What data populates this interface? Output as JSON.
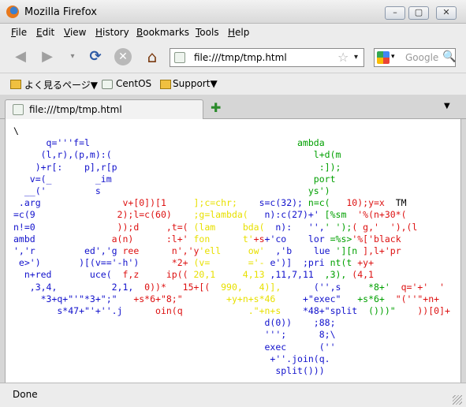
{
  "window": {
    "title": "Mozilla Firefox",
    "btn_min": "–",
    "btn_max": "▢",
    "btn_close": "✕"
  },
  "menu": [
    "File",
    "Edit",
    "View",
    "History",
    "Bookmarks",
    "Tools",
    "Help"
  ],
  "nav": {
    "back_glyph": "◀",
    "forward_glyph": "▶",
    "history_drop_glyph": "▾",
    "reload_glyph": "⟳",
    "stop_glyph": "✕",
    "home_glyph": "⌂",
    "url": "file:///tmp/tmp.html",
    "star_glyph": "☆",
    "url_drop_glyph": "▾",
    "search_placeholder": "Google",
    "search_drop_glyph": "▾",
    "search_go_glyph": "🔍"
  },
  "bookmarks": [
    "よく見るページ▼",
    "CentOS",
    "Support▼"
  ],
  "tab": {
    "label": "file:///tmp/tmp.html",
    "new_tab_glyph": "✚",
    "list_glyph": "▼"
  },
  "status": "Done",
  "icons": [
    "firefox-logo-icon",
    "back-arrow-icon",
    "forward-arrow-icon",
    "reload-icon",
    "stop-icon",
    "home-icon",
    "page-icon",
    "bookmark-star-icon",
    "google-icon",
    "magnifier-icon",
    "folder-icon",
    "new-tab-icon"
  ],
  "colors": {
    "black": "#000000",
    "blue": "#1111cc",
    "green": "#00a000",
    "red": "#dd1010",
    "yellow": "#e8e000"
  },
  "code_lines": [
    [
      [
        "k",
        "\\"
      ]
    ],
    [
      [
        "b",
        "      q='''f=l"
      ],
      [
        "g",
        "                                      ambda"
      ]
    ],
    [
      [
        "b",
        "     (l,r),(p,m):("
      ],
      [
        "g",
        "                                     l+d(m"
      ]
    ],
    [
      [
        "b",
        "    )+r[:    p],r[p"
      ],
      [
        "g",
        "                                     :]);"
      ]
    ],
    [
      [
        "b",
        "   v=(_        _im"
      ],
      [
        "g",
        "                                     port"
      ]
    ],
    [
      [
        "b",
        "  __('         s"
      ],
      [
        "g",
        "                                      ys')"
      ]
    ],
    [
      [
        "b",
        " .arg"
      ],
      [
        "r",
        "               v+[0])[1"
      ],
      [
        "y",
        "     ];c=chr;"
      ],
      [
        "b",
        "    s=c(32);"
      ],
      [
        "g",
        " n=c("
      ],
      [
        "r",
        "   10);y=x"
      ],
      [
        "k",
        "  TM"
      ]
    ],
    [
      [
        "b",
        "=c(9"
      ],
      [
        "r",
        "               2);l=c(60)"
      ],
      [
        "y",
        "    ;g=lambda("
      ],
      [
        "b",
        "   n):c(27)+'"
      ],
      [
        "g",
        " [%sm"
      ],
      [
        "r",
        "  '%(n+30*("
      ]
    ],
    [
      [
        "b",
        "n!=0"
      ],
      [
        "r",
        "               ));d     ,t=("
      ],
      [
        "y",
        " (lam     bda("
      ],
      [
        "b",
        "  n):   '',"
      ],
      [
        "g",
        "' ');"
      ],
      [
        "r",
        "( g,'  '),(l"
      ]
    ],
    [
      [
        "b",
        "ambd"
      ],
      [
        "r",
        "              a(n)      :l+'"
      ],
      [
        "y",
        " fon      t'"
      ],
      [
        "r",
        "+s"
      ],
      [
        "b",
        "+'co    lor"
      ],
      [
        "g",
        " =%s>"
      ],
      [
        "r",
        "'%['black"
      ]
    ],
    [
      [
        "b",
        "','r         ed','g"
      ],
      [
        "r",
        " ree      n','y"
      ],
      [
        "y",
        "'ell     ow'"
      ],
      [
        "b",
        "  ,'b    lue"
      ],
      [
        "g",
        " '][n"
      ],
      [
        "r",
        " ],l+'pr"
      ]
    ],
    [
      [
        "b",
        " e>')       )[(v=='-h')"
      ],
      [
        "r",
        "      *2+ "
      ],
      [
        "y",
        "(v=       ='-"
      ],
      [
        "b",
        " e')]  ;pri"
      ],
      [
        "g",
        " nt(t"
      ],
      [
        "r",
        " +y+"
      ]
    ],
    [
      [
        "b",
        "  n+red       uce("
      ],
      [
        "r",
        "  f,z     ip(("
      ],
      [
        "y",
        " 20,1     4,13"
      ],
      [
        "b",
        " ,11,7,11"
      ],
      [
        "g",
        "  ,3),"
      ],
      [
        "r",
        " (4,1"
      ]
    ],
    [
      [
        "b",
        "   ,3,4,          2,1,"
      ],
      [
        "r",
        "  0))*   15+[("
      ],
      [
        "y",
        "  990,   4)],"
      ],
      [
        "b",
        "      ('',s"
      ],
      [
        "g",
        "     *8+'"
      ],
      [
        "r",
        "  q='+'  '"
      ]
    ],
    [
      [
        "b",
        "     *3+q+\"'\"*3+\";\""
      ],
      [
        "r",
        "   +s*6+\"8;\""
      ],
      [
        "y",
        "        +y+n+s*46"
      ],
      [
        "b",
        "     +\"exec\""
      ],
      [
        "g",
        "   +s*6+"
      ],
      [
        "r",
        "  \"(''\"+n+"
      ]
    ],
    [
      [
        "b",
        "        s*47+\"'+''.j"
      ],
      [
        "r",
        "      oin(q"
      ],
      [
        "y",
        "            .\"+n+s"
      ],
      [
        "b",
        "    *48+\"split"
      ],
      [
        "g",
        "  ()))\""
      ],
      [
        "r",
        "    ))[0]+"
      ]
    ],
    [
      [
        "b",
        "                                              d(0))    ;88;"
      ]
    ],
    [
      [
        "b",
        "                                              ''';      8;\\"
      ]
    ],
    [
      [
        "b",
        "                                              exec      (''"
      ]
    ],
    [
      [
        "b",
        "                                               +''.join(q."
      ]
    ],
    [
      [
        "b",
        "                                                split()))"
      ]
    ]
  ]
}
